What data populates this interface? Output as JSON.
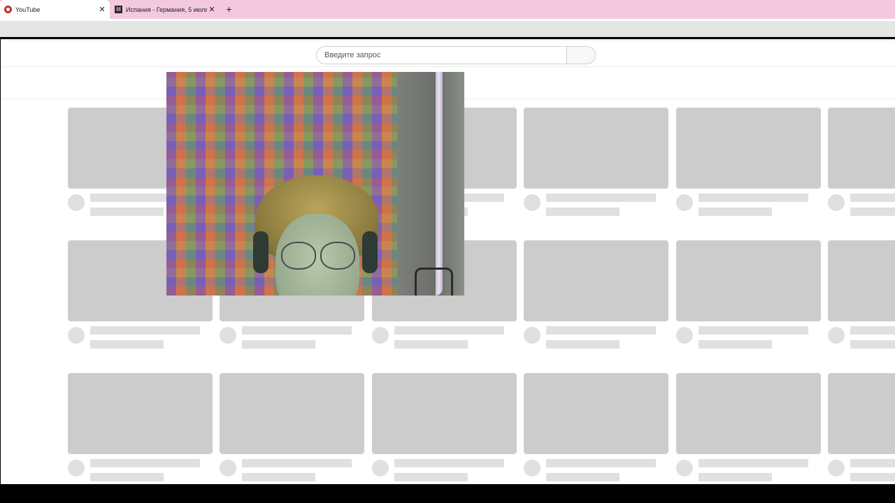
{
  "browser": {
    "tabs": [
      {
        "title": "YouTube",
        "active": true,
        "icon": "youtube-favicon"
      },
      {
        "title": "Испания - Германия, 5 июля 2",
        "active": false,
        "icon": "m-favicon"
      }
    ],
    "close_glyph": "✕",
    "new_tab_glyph": "+"
  },
  "search": {
    "placeholder": "Введите запрос"
  },
  "feed": {
    "state": "loading-skeleton",
    "rows": 3,
    "columns": 6
  },
  "overlay": {
    "type": "webcam-feed",
    "icon": "webcam-video"
  },
  "colors": {
    "tab_strip": "#f4c9df",
    "skeleton_thumb": "#cccccc",
    "skeleton_text": "#e0e0e0",
    "page_bg": "#ffffff"
  }
}
